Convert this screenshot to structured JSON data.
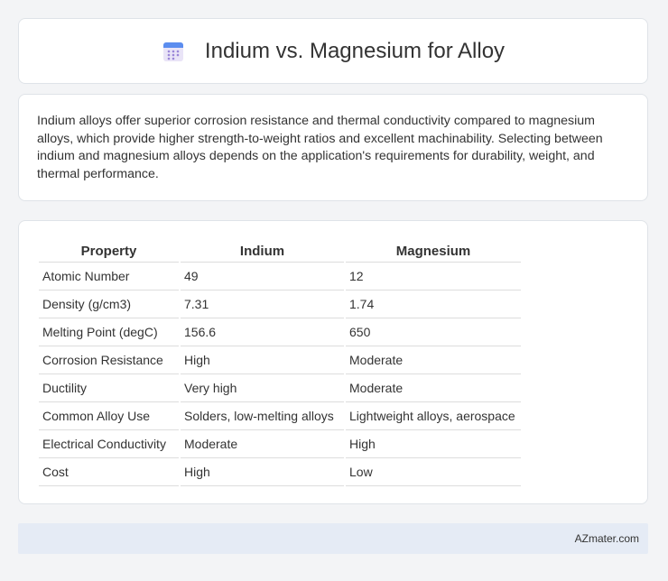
{
  "header": {
    "title": "Indium vs. Magnesium for Alloy",
    "icon": "calendar-icon"
  },
  "intro": {
    "text": "Indium alloys offer superior corrosion resistance and thermal conductivity compared to magnesium alloys, which provide higher strength-to-weight ratios and excellent machinability. Selecting between indium and magnesium alloys depends on the application's requirements for durability, weight, and thermal performance."
  },
  "table": {
    "headers": [
      "Property",
      "Indium",
      "Magnesium"
    ],
    "rows": [
      [
        "Atomic Number",
        "49",
        "12"
      ],
      [
        "Density (g/cm3)",
        "7.31",
        "1.74"
      ],
      [
        "Melting Point (degC)",
        "156.6",
        "650"
      ],
      [
        "Corrosion Resistance",
        "High",
        "Moderate"
      ],
      [
        "Ductility",
        "Very high",
        "Moderate"
      ],
      [
        "Common Alloy Use",
        "Solders, low-melting alloys",
        "Lightweight alloys, aerospace"
      ],
      [
        "Electrical Conductivity",
        "Moderate",
        "High"
      ],
      [
        "Cost",
        "High",
        "Low"
      ]
    ]
  },
  "footer": {
    "site": "AZmater.com"
  }
}
